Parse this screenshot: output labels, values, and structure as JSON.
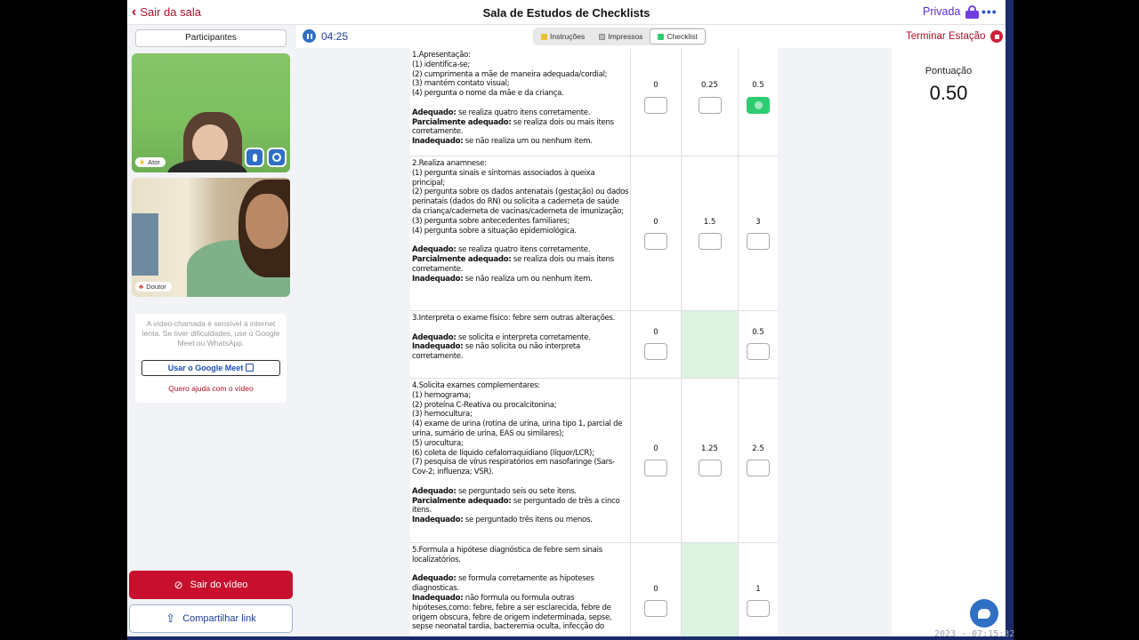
{
  "header": {
    "back_label": "Sair da sala",
    "title": "Sala de Estudos de Checklists",
    "privacy_label": "Privada"
  },
  "sidebar": {
    "participants_label": "Participantes",
    "tiles": [
      {
        "role": "Ator"
      },
      {
        "role": "Doutor"
      }
    ],
    "help_text": "A vídeo-chamada é sensível à internet lenta. Se tiver dificuldades, use o Google Meet ou WhatsApp.",
    "meet_button": "Usar o Google Meet",
    "help_link": "Quero ajuda com o vídeo",
    "leave_video": "Sair do vídeo",
    "share_link": "Compartilhar link"
  },
  "toolbar": {
    "timer": "04:25",
    "tabs": [
      {
        "label": "Instruções",
        "active": false
      },
      {
        "label": "Impressos",
        "active": false
      },
      {
        "label": "Checklist",
        "active": true
      }
    ],
    "end_station": "Terminar Estação"
  },
  "score_panel": {
    "label": "Pontuação",
    "value": "0.50"
  },
  "checklist": [
    {
      "lines": [
        "1.Apresentação:",
        "(1) identifica-se;",
        "(2) cumprimenta a mãe de maneira adequada/cordial;",
        "(3) mantém contato visual;",
        "(4) pergunta o nome da mãe e da criança."
      ],
      "adequado": "se realiza quatro itens corretamente.",
      "parcial": "se realiza dois ou mais itens corretamente.",
      "inadequado": "se não realiza um ou nenhum item.",
      "scores": [
        "0",
        "0.25",
        "0.5"
      ],
      "checked": 2
    },
    {
      "lines": [
        "2.Realiza anamnese:",
        "(1) pergunta sinais e sintomas associados à queixa principal;",
        "(2) pergunta sobre os dados antenatais (gestação) ou dados perinatais (dados do RN) ou solicita a caderneta de saúde da criança/caderneta de vacinas/caderneta de imunização;",
        "(3) pergunta sobre antecedentes familiares;",
        "(4) pergunta sobre a situação epidemiológica."
      ],
      "adequado": "se realiza quatro itens corretamente.",
      "parcial": "se realiza dois ou mais itens corretamente.",
      "inadequado": "se não realiza um ou nenhum item.",
      "scores": [
        "0",
        "1.5",
        "3"
      ],
      "checked": -1
    },
    {
      "lines": [
        "3.Interpreta o exame físico: febre sem outras alterações."
      ],
      "adequado": "se solicita e interpreta corretamente.",
      "parcial": "",
      "inadequado": "se não solicita ou não interpreta corretamente.",
      "scores": [
        "0",
        "",
        "0.5"
      ],
      "checked": -1
    },
    {
      "lines": [
        "4.Solicita exames complementares:",
        "(1) hemograma;",
        "(2) proteína C-Reativa ou procalcitonina;",
        "(3) hemocultura;",
        "(4) exame de urina (rotina de urina, urina tipo 1, parcial de urina, sumário de urina, EAS ou similares);",
        "(5) urocultura;",
        "(6) coleta de líquido cefalorraquidiano (líquor/LCR);",
        "(7) pesquisa de vírus respiratórios em nasofaringe (Sars-Cov-2; influenza; VSR)."
      ],
      "adequado": "se perguntado seis ou sete itens.",
      "parcial": "se perguntado de três a cinco itens.",
      "inadequado": "se perguntado três itens ou menos.",
      "scores": [
        "0",
        "1.25",
        "2.5"
      ],
      "checked": -1
    },
    {
      "lines": [
        "5.Formula a hipótese diagnóstica de febre sem sinais localizatórios."
      ],
      "adequado": "se formula corretamente as hipoteses diagnosticas.",
      "parcial": "",
      "inadequado": "não formula ou formula outras hipóteses,como: febre, febre a ser esclarecida, febre de origem obscura, febre de origem indeterminada, sepse, sepse neonatal tardia, bacteremia oculta, infecção do",
      "scores": [
        "0",
        "",
        "1"
      ],
      "checked": -1
    }
  ],
  "labels": {
    "adequado": "Adequado:",
    "parcial": "Parcialmente adequado:",
    "inadequado": "Inadequado:"
  },
  "colors": {
    "brand_red": "#c8102e",
    "accent_blue": "#2f6fc4",
    "privacy_purple": "#6f3ee0",
    "checked_green": "#2ecc71",
    "na_cell_green": "#ddf3e2"
  },
  "status_clock": "2023 - 07:15:32"
}
